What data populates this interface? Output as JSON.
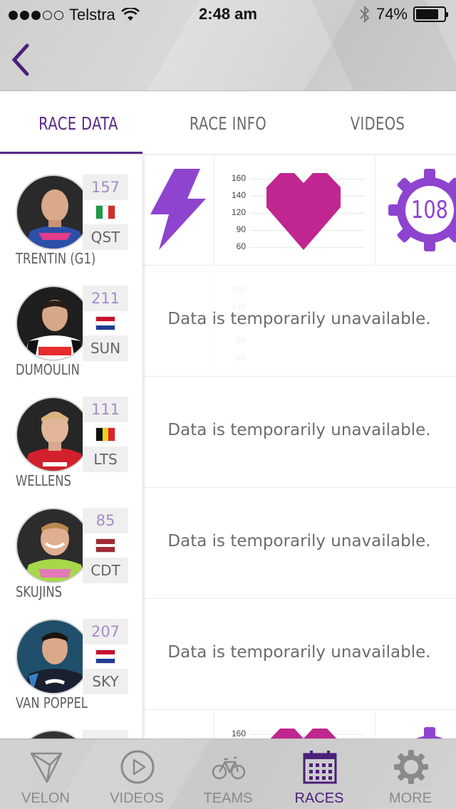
{
  "status_bar": {
    "carrier": "Telstra",
    "time": "2:48 am",
    "battery": "74%"
  },
  "header": {
    "back_icon": "chevron-left-icon"
  },
  "tabs": [
    {
      "label": "RACE DATA",
      "active": true
    },
    {
      "label": "RACE INFO",
      "active": false
    },
    {
      "label": "VIDEOS",
      "active": false
    }
  ],
  "riders": [
    {
      "number": "157",
      "team": "QST",
      "name": "TRENTIN (G1)",
      "flag": "italy"
    },
    {
      "number": "211",
      "team": "SUN",
      "name": "DUMOULIN",
      "flag": "netherlands"
    },
    {
      "number": "111",
      "team": "LTS",
      "name": "WELLENS",
      "flag": "belgium"
    },
    {
      "number": "85",
      "team": "CDT",
      "name": "SKUJINS",
      "flag": "latvia"
    },
    {
      "number": "207",
      "team": "SKY",
      "name": "VAN POPPEL",
      "flag": "netherlands"
    }
  ],
  "race_data": {
    "hr_ticks": [
      "160",
      "140",
      "120",
      "90",
      "60"
    ],
    "cadence_value": "108",
    "unavailable_message": "Data is temporarily unavailable.",
    "accent_purple": "#8e44cf",
    "heart_color": "#c0268f"
  },
  "bottom_nav": [
    {
      "label": "VELON",
      "icon": "velon-logo-icon",
      "active": false
    },
    {
      "label": "VIDEOS",
      "icon": "play-circle-icon",
      "active": false
    },
    {
      "label": "TEAMS",
      "icon": "bicycle-icon",
      "active": false
    },
    {
      "label": "RACES",
      "icon": "calendar-icon",
      "active": true
    },
    {
      "label": "MORE",
      "icon": "gear-icon",
      "active": false
    }
  ]
}
